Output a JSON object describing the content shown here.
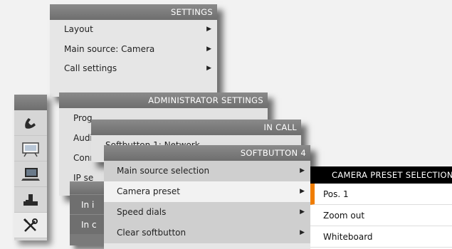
{
  "settings": {
    "title": "SETTINGS",
    "items": [
      {
        "label": "Layout"
      },
      {
        "label": "Main source: Camera"
      },
      {
        "label": "Call settings"
      }
    ]
  },
  "admin": {
    "title": "ADMINISTRATOR SETTINGS",
    "items": [
      {
        "label": "Prog"
      },
      {
        "label": "Audi"
      },
      {
        "label": "Conn"
      },
      {
        "label": "IP se"
      }
    ]
  },
  "inner": {
    "items": [
      {
        "label": "In i"
      },
      {
        "label": "In c"
      }
    ]
  },
  "incall": {
    "title": "IN CALL",
    "items": [
      {
        "label": "Softbutton 1: Network"
      }
    ]
  },
  "softbutton": {
    "title": "SOFTBUTTON 4",
    "items": [
      {
        "label": "Main source selection"
      },
      {
        "label": "Camera preset"
      },
      {
        "label": "Speed dials"
      },
      {
        "label": "Clear softbutton"
      }
    ]
  },
  "camera": {
    "title": "CAMERA PRESET SELECTION",
    "items": [
      {
        "label": "Pos. 1"
      },
      {
        "label": "Zoom out"
      },
      {
        "label": "Whiteboard"
      }
    ]
  },
  "sidebar": {
    "icons": [
      "phone-icon",
      "presentation-icon",
      "laptop-icon",
      "camera-icon",
      "tools-icon"
    ]
  },
  "colors": {
    "accent": "#f07d00",
    "title_bar": "#7a7a7a",
    "panel_bg": "#e6e6e6"
  }
}
